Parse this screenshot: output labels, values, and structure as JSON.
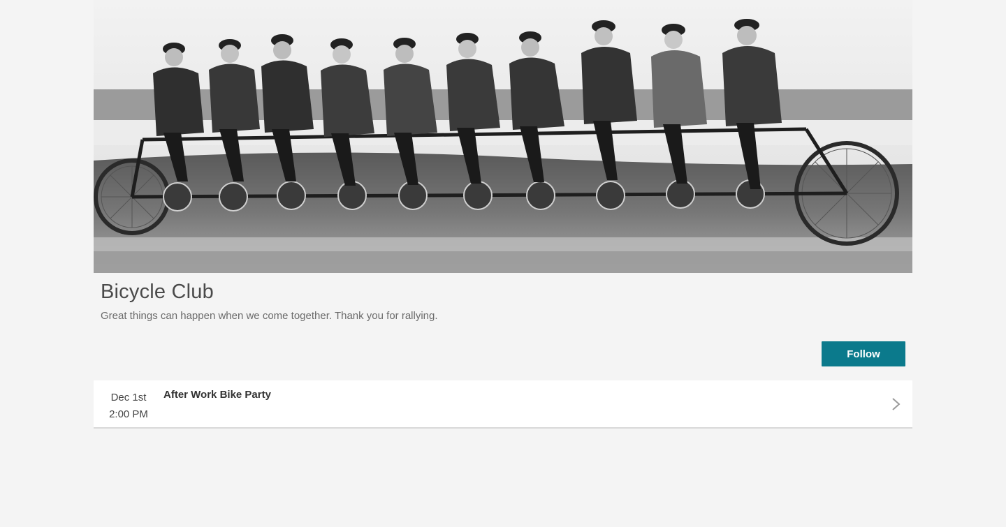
{
  "club": {
    "title": "Bicycle Club",
    "tagline": "Great things can happen when we come together. Thank you for rallying.",
    "follow_label": "Follow"
  },
  "events": [
    {
      "date": "Dec 1st",
      "time": "2:00 PM",
      "title": "After Work Bike Party"
    }
  ],
  "colors": {
    "accent": "#0b7a8c",
    "background": "#f4f4f4"
  },
  "icons": {
    "event_row": "chevron-right-icon"
  }
}
